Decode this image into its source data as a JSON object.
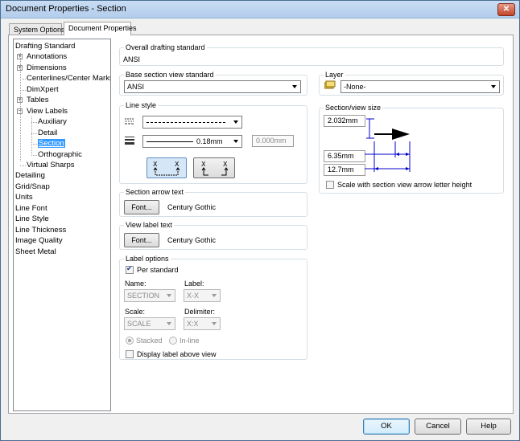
{
  "window": {
    "title": "Document Properties - Section",
    "close_symbol": "✕"
  },
  "tabs": [
    "System Options",
    "Document Properties"
  ],
  "tree": {
    "items": [
      {
        "label": "Drafting Standard",
        "level": 0,
        "expander": ""
      },
      {
        "label": "Annotations",
        "level": 1,
        "expander": "+"
      },
      {
        "label": "Dimensions",
        "level": 1,
        "expander": "+"
      },
      {
        "label": "Centerlines/Center Marks",
        "level": 1,
        "expander": ""
      },
      {
        "label": "DimXpert",
        "level": 1,
        "expander": ""
      },
      {
        "label": "Tables",
        "level": 1,
        "expander": "+"
      },
      {
        "label": "View Labels",
        "level": 1,
        "expander": "−"
      },
      {
        "label": "Auxiliary",
        "level": 2,
        "expander": ""
      },
      {
        "label": "Detail",
        "level": 2,
        "expander": ""
      },
      {
        "label": "Section",
        "level": 2,
        "expander": "",
        "selected": true
      },
      {
        "label": "Orthographic",
        "level": 2,
        "expander": ""
      },
      {
        "label": "Virtual Sharps",
        "level": 1,
        "expander": ""
      },
      {
        "label": "Detailing",
        "level": 0,
        "expander": ""
      },
      {
        "label": "Grid/Snap",
        "level": 0,
        "expander": ""
      },
      {
        "label": "Units",
        "level": 0,
        "expander": ""
      },
      {
        "label": "Line Font",
        "level": 0,
        "expander": ""
      },
      {
        "label": "Line Style",
        "level": 0,
        "expander": ""
      },
      {
        "label": "Line Thickness",
        "level": 0,
        "expander": ""
      },
      {
        "label": "Image Quality",
        "level": 0,
        "expander": ""
      },
      {
        "label": "Sheet Metal",
        "level": 0,
        "expander": ""
      }
    ]
  },
  "overall": {
    "title": "Overall drafting standard",
    "value": "ANSI"
  },
  "base_section": {
    "title": "Base section view standard",
    "value": "ANSI"
  },
  "layer": {
    "title": "Layer",
    "value": "-None-"
  },
  "line_style": {
    "title": "Line style",
    "thickness_value": "0.18mm",
    "custom_thickness": "0.000mm"
  },
  "section_size": {
    "title": "Section/view size",
    "values": [
      "2.032mm",
      "6.35mm",
      "12.7mm"
    ],
    "scale_checkbox": "Scale with section view arrow letter height"
  },
  "section_arrow_text": {
    "title": "Section arrow text",
    "font_button": "Font...",
    "font_name": "Century Gothic"
  },
  "view_label_text": {
    "title": "View label text",
    "font_button": "Font...",
    "font_name": "Century Gothic"
  },
  "label_options": {
    "title": "Label options",
    "per_standard": "Per standard",
    "name_label": "Name:",
    "name_value": "SECTION",
    "label_label": "Label:",
    "label_value": "X-X",
    "scale_label": "Scale:",
    "scale_value": "SCALE",
    "delimiter_label": "Delimiter:",
    "delimiter_value": "X:X",
    "stacked": "Stacked",
    "inline": "In-line",
    "display_above": "Display label above view"
  },
  "footer": {
    "ok": "OK",
    "cancel": "Cancel",
    "help": "Help"
  }
}
